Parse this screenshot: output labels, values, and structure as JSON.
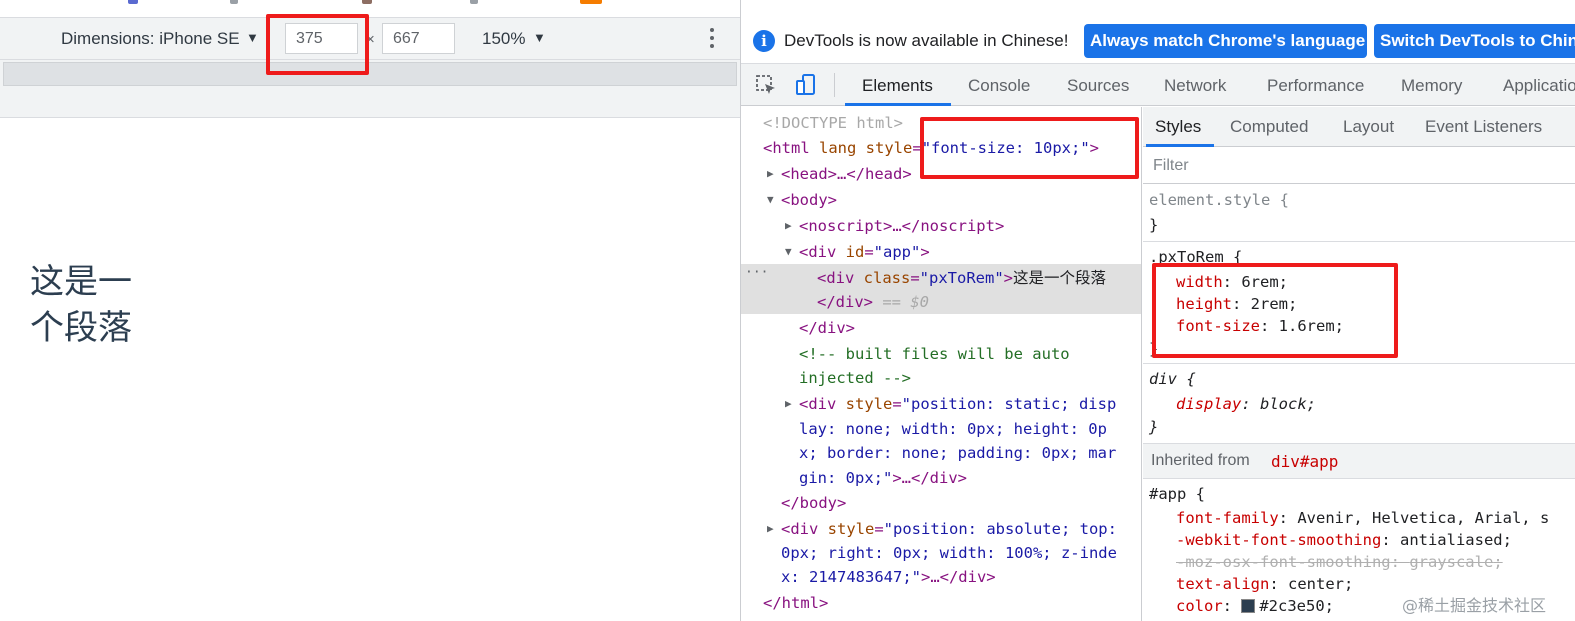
{
  "device_toolbar": {
    "dimensions_label": "Dimensions: iPhone SE",
    "width_value": "375",
    "times": "×",
    "height_value": "667",
    "zoom": "150%"
  },
  "viewport": {
    "paragraph_line1": "这是一",
    "paragraph_line2": "个段落"
  },
  "infobar": {
    "message": "DevTools is now available in Chinese!",
    "btn_match": "Always match Chrome's language",
    "btn_switch": "Switch DevTools to Chinese"
  },
  "main_tabs": [
    "Elements",
    "Console",
    "Sources",
    "Network",
    "Performance",
    "Memory",
    "Application"
  ],
  "active_main_tab": "Elements",
  "elements_tree": {
    "doctype": "<!DOCTYPE html>",
    "html_open_tag": "<html",
    "html_attr_lang": " lang",
    "html_attr_style": " style",
    "html_eq": "=",
    "html_style_value": "\"font-size: 10px;\"",
    "html_close": ">",
    "head": "<head>…</head>",
    "body_open": "<body>",
    "noscript": "<noscript>…</noscript>",
    "div_app_open": "<div",
    "div_app_attr": " id",
    "div_app_eq": "=",
    "div_app_val": "\"app\"",
    "div_app_close": ">",
    "selected_div_open": "<div",
    "selected_div_attr": " class",
    "selected_div_eq": "=",
    "selected_div_val": "\"pxToRem\"",
    "selected_div_gt": ">",
    "selected_div_text": "这是一个段落",
    "selected_div_close": "</div>",
    "selected_marker": " == $0",
    "div_close": "</div>",
    "comment_line1": "<!-- built files will be auto",
    "comment_line2": "injected -->",
    "div_static_l1_tag": "<div",
    "div_static_l1_attr": " style",
    "div_static_l1_eq": "=",
    "div_static_l1_val": "\"position: static; disp",
    "div_static_l2": "lay: none; width: 0px; height: 0p",
    "div_static_l3": "x; border: none; padding: 0px; mar",
    "div_static_l4_val": "gin: 0px;\"",
    "div_static_l4_rest": ">…</div>",
    "body_close": "</body>",
    "div_abs_l1_tag": "<div",
    "div_abs_l1_attr": " style",
    "div_abs_l1_eq": "=",
    "div_abs_l1_val": "\"position: absolute; top:",
    "div_abs_l2": "0px; right: 0px; width: 100%; z-inde",
    "div_abs_l3_val": "x: 2147483647;\"",
    "div_abs_l3_rest": ">…</div>",
    "html_end": "</html>",
    "ellipsis": "···"
  },
  "styles_tabs": [
    "Styles",
    "Computed",
    "Layout",
    "Event Listeners"
  ],
  "active_styles_tab": "Styles",
  "filter_placeholder": "Filter",
  "styles": {
    "element_style_selector": "element.style {",
    "close_brace": "}",
    "pxtorem_selector": ".pxToRem {",
    "pxtorem_props": [
      {
        "name": "width",
        "value": "6rem"
      },
      {
        "name": "height",
        "value": "2rem"
      },
      {
        "name": "font-size",
        "value": "1.6rem"
      }
    ],
    "div_selector": "div {",
    "div_prop": {
      "name": "display",
      "value": "block"
    },
    "inherited_label": "Inherited from ",
    "inherited_from": "div#app",
    "app_selector": "#app {",
    "app_props": [
      {
        "name": "font-family",
        "value": "Avenir, Helvetica, Arial, s"
      },
      {
        "name": "-webkit-font-smoothing",
        "value": "antialiased"
      },
      {
        "name": "-moz-osx-font-smoothing",
        "value": "grayscale",
        "struck": true
      },
      {
        "name": "text-align",
        "value": "center"
      },
      {
        "name": "color",
        "value": "#2c3e50"
      }
    ]
  },
  "watermark": "@稀土掘金技术社区",
  "colors": {
    "accent": "#1a73e8",
    "highlight_red": "#ee1b1b",
    "text_color_value": "#2c3e50"
  }
}
